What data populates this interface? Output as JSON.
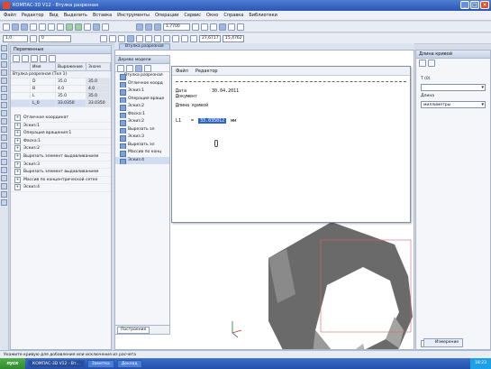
{
  "window": {
    "title": "КОМПАС-3D V12 - Втулка разрезная"
  },
  "menu": [
    "Файл",
    "Редактор",
    "Вид",
    "Выделить",
    "Вставка",
    "Инструменты",
    "Операции",
    "Сервис",
    "Окно",
    "Справка",
    "Библиотеки"
  ],
  "toolbar": {
    "scale_value": "1,0",
    "layer_value": "0",
    "zoom_value": "1,7700",
    "coord_x": "27,6717",
    "coord_y": "15,4762"
  },
  "variables_panel": {
    "title": "Переменные",
    "columns": [
      "Имя",
      "Выражение",
      "Значе"
    ],
    "root": "Втулка разрезная (Тел 1)",
    "rows": [
      {
        "name": "D",
        "expr": "35.0",
        "value": "35.0"
      },
      {
        "name": "B",
        "expr": "4.0",
        "value": "4.0"
      },
      {
        "name": "L",
        "expr": "35.0",
        "value": "35.0"
      },
      {
        "name": "L_0",
        "expr": "33.0350",
        "value": "33.0350"
      }
    ],
    "items": [
      "Отличное координат",
      "Эскиз:1",
      "Операция вращения:1",
      "Фаска:1",
      "Эскиз:2",
      "Вырезать элемент выдавливанием",
      "Эскиз:3",
      "Вырезать элемент выдавливанием",
      "Массив по концентрической сетке",
      "Эскиз:4"
    ]
  },
  "tree_panel": {
    "title": "Дерево модели",
    "tab": "Втулка разрезная",
    "items": [
      "Втулка разрезная",
      "Отличное коорд",
      "Эскиз:1",
      "Операция враще",
      "Эскиз:2",
      "Фаска:1",
      "Эскиз:2",
      "Вырезать эл",
      "Эскиз:3",
      "Вырезать эл",
      "Массив по конц",
      "Эскиз:4"
    ],
    "bottom_tab": "Построение"
  },
  "dialog": {
    "menu": [
      "Файл",
      "Редактор"
    ],
    "date_label": "Дата",
    "date_value": "30.04.2011",
    "doc_label": "Документ",
    "curve_label": "Длина кривой",
    "measure_name": "L1",
    "measure_eq": "=",
    "measure_value": "33.035012",
    "measure_unit": "мм"
  },
  "right_panel": {
    "title": "Длина кривой",
    "field1_label": "Т (0)",
    "field1_value": "",
    "field2_label": "Длина",
    "field2_value": "миллиметры",
    "bottom_value": "0",
    "bottom_tab": "Измерение"
  },
  "status": {
    "text": "Укажите кривую для добавления или исключения из расчета"
  },
  "taskbar": {
    "start": "пуск",
    "buttons": [
      "КОМПАС-3D V12 - Вт...",
      "Заметка",
      "Доклад"
    ],
    "clock": "18:23"
  },
  "colors": {
    "accent": "#2b56b0",
    "selection": "#2e63c8"
  }
}
